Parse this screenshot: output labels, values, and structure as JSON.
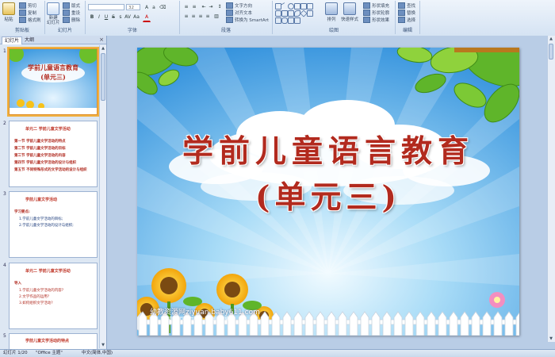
{
  "ribbon": {
    "clipboard": {
      "paste": "粘贴",
      "cut": "剪切",
      "copy": "复制",
      "format_painter": "格式刷",
      "label": "剪贴板"
    },
    "slides": {
      "new_slide": "新建\n幻灯片",
      "layout": "版式",
      "reset": "重设",
      "delete": "删除",
      "label": "幻灯片"
    },
    "font": {
      "size_value": "32",
      "label": "字体"
    },
    "paragraph": {
      "text_direction": "文字方向",
      "align_text": "对齐文本",
      "convert_smartart": "转换为 SmartArt",
      "label": "段落"
    },
    "drawing": {
      "arrange": "排列",
      "quick_styles": "快速样式",
      "shape_fill": "形状填充",
      "shape_outline": "形状轮廓",
      "shape_effects": "形状效果",
      "label": "绘图"
    },
    "editing": {
      "find": "查找",
      "replace": "替换",
      "select": "选择",
      "label": "编辑"
    }
  },
  "pane": {
    "tabs": [
      "幻灯片",
      "大纲"
    ],
    "close": "×",
    "thumbs": [
      {
        "num": "1",
        "line1": "学前儿童语言教育",
        "line2": "(单元三)"
      },
      {
        "num": "2",
        "title": "单元二  学前儿童文学活动",
        "items": [
          "第一节  学前儿童文学活动的特点",
          "第二节  学前儿童文学活动的目标",
          "第三节  学前儿童文学活动的内容",
          "第四节  学前儿童文学活动的设计与组织",
          "第五节  不同特殊形式的文学活动的设计与组织"
        ]
      },
      {
        "num": "3",
        "title": "学前儿童文学活动",
        "items": [
          "学习要点:",
          "1.学前儿童文学活动的目标;",
          "2.学前儿童文学活动的设计与组织;"
        ]
      },
      {
        "num": "4",
        "title": "单元二  学前儿童文学活动",
        "items": [
          "导入",
          "1.学前儿童文学活动的内容?",
          "2.文学作品的运用?",
          "3.如何组织文学活动?"
        ]
      },
      {
        "num": "5",
        "title": "学前儿童文学活动的特点"
      }
    ]
  },
  "slide": {
    "title_line1": "学前儿童语言教育",
    "title_line2": "(单元三)",
    "watermark": "幼教资源网ziyuan.baby611.com",
    "watermark_small": "PPT课件、FLASH课件、教案资源下载"
  },
  "status": {
    "slide_pos": "幻灯片 1/20",
    "theme": "\"Office 主题\"",
    "language": "中文(简体,中国)"
  },
  "colors": {
    "title_red": "#b22a1e",
    "sky": "#3f9be0",
    "ribbon": "#d5e3f3"
  }
}
